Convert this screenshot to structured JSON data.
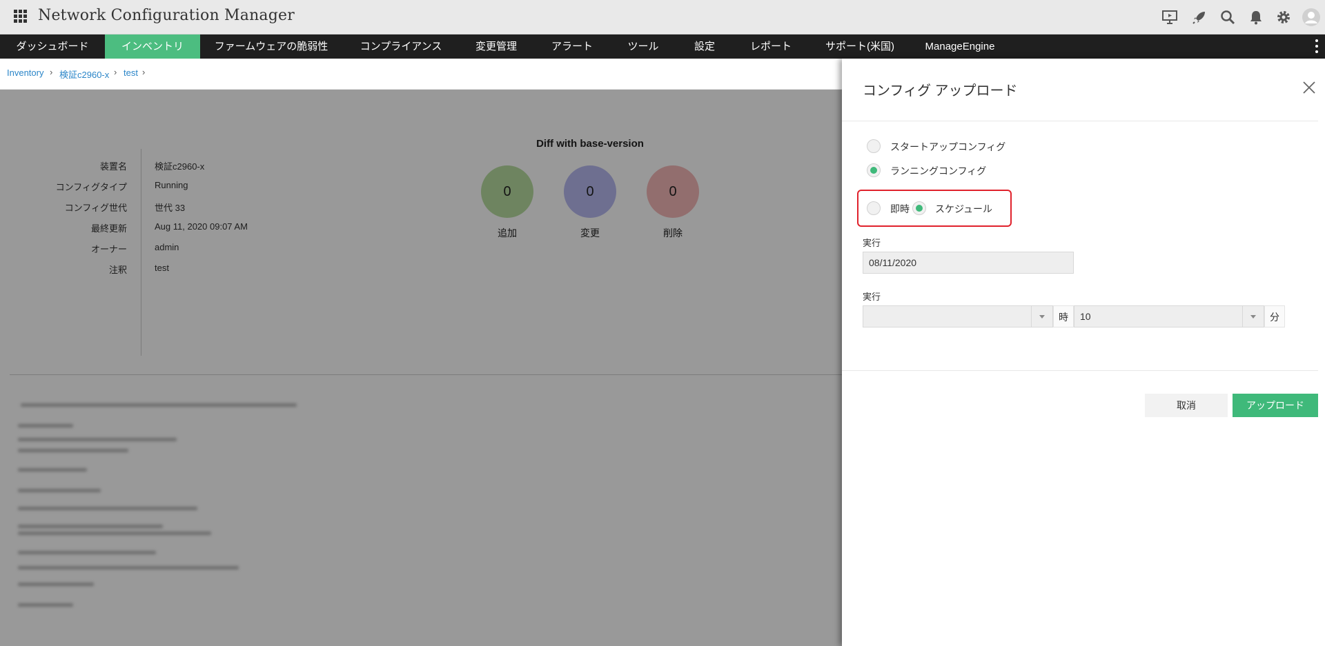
{
  "app": {
    "title": "Network Configuration Manager"
  },
  "header_icons": [
    "presentation-icon",
    "rocket-icon",
    "search-icon",
    "bell-icon",
    "gear-icon",
    "user-avatar-icon"
  ],
  "nav": {
    "items": [
      {
        "label": "ダッシュボード",
        "active": false
      },
      {
        "label": "インベントリ",
        "active": true
      },
      {
        "label": "ファームウェアの脆弱性",
        "active": false
      },
      {
        "label": "コンプライアンス",
        "active": false
      },
      {
        "label": "変更管理",
        "active": false
      },
      {
        "label": "アラート",
        "active": false
      },
      {
        "label": "ツール",
        "active": false
      },
      {
        "label": "設定",
        "active": false
      },
      {
        "label": "レポート",
        "active": false
      },
      {
        "label": "サポート(米国)",
        "active": false
      },
      {
        "label": "ManageEngine",
        "active": false
      }
    ]
  },
  "breadcrumb": [
    "Inventory",
    "検証c2960-x",
    "test"
  ],
  "details": [
    {
      "label": "装置名",
      "value": "検証c2960-x"
    },
    {
      "label": "コンフィグタイプ",
      "value": "Running"
    },
    {
      "label": "コンフィグ世代",
      "value": "世代 33"
    },
    {
      "label": "最終更新",
      "value": "Aug 11, 2020 09:07 AM"
    },
    {
      "label": "オーナー",
      "value": "admin"
    },
    {
      "label": "注釈",
      "value": "test"
    }
  ],
  "diff": {
    "title": "Diff with base-version",
    "added": {
      "count": "0",
      "label": "追加",
      "color": "#b8dca0"
    },
    "changed": {
      "count": "0",
      "label": "変更",
      "color": "#b8baf0"
    },
    "deleted": {
      "count": "0",
      "label": "削除",
      "color": "#f3b8b8"
    }
  },
  "panel": {
    "title": "コンフィグ アップロード",
    "config_type": {
      "startup_label": "スタートアップコンフィグ",
      "running_label": "ランニングコンフィグ",
      "selected": "running"
    },
    "timing": {
      "immediate_label": "即時",
      "schedule_label": "スケジュール",
      "selected": "schedule"
    },
    "date_label": "実行",
    "date_value": "08/11/2020",
    "time_label": "実行",
    "hour_value": "",
    "hour_unit": "時",
    "minute_value": "10",
    "minute_unit": "分",
    "cancel_label": "取消",
    "upload_label": "アップロード"
  },
  "colors": {
    "accent_green": "#3fb97a",
    "nav_bg": "#1f1f1f",
    "nav_active": "#4cbd80",
    "link": "#2a85c8",
    "highlight_red": "#e0212b"
  }
}
